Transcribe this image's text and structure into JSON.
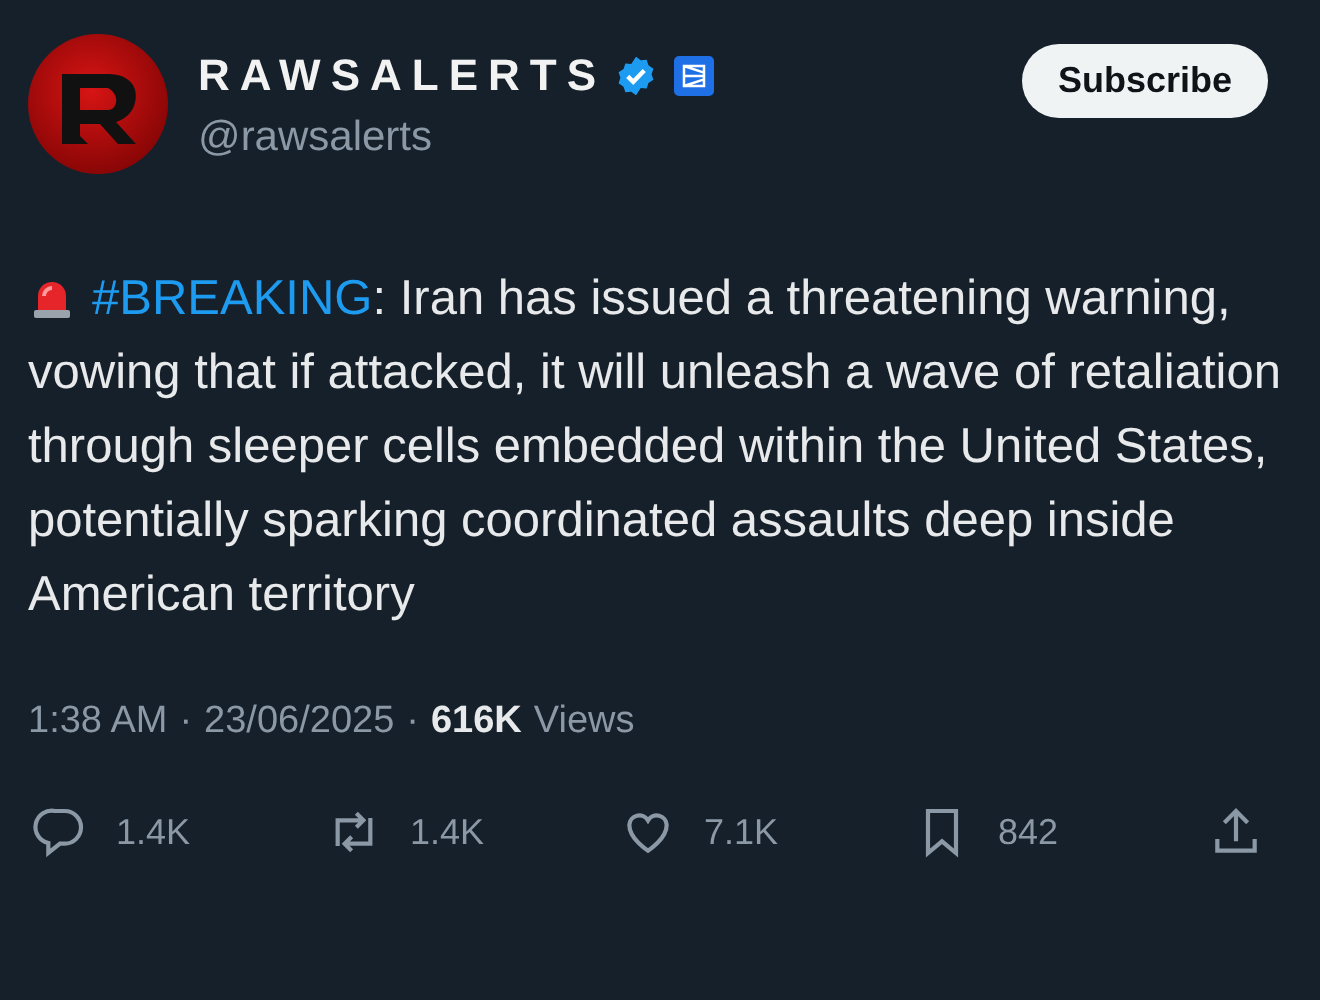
{
  "author": {
    "name": "RAWSALERTS",
    "handle": "@rawsalerts",
    "verified": true,
    "affiliate_badge": true
  },
  "subscribe_button": "Subscribe",
  "post": {
    "hashtag": "#BREAKING",
    "text": ": Iran has issued a threatening warning, vowing that if attacked, it will unleash a wave of retaliation through sleeper cells embedded within the United States, potentially sparking coordinated assaults deep inside American territory"
  },
  "meta": {
    "time": "1:38 AM",
    "separator_1": "·",
    "date": "23/06/2025",
    "separator_2": "·",
    "views_count": "616K",
    "views_label": "Views"
  },
  "actions": [
    {
      "kind": "reply",
      "count": "1.4K"
    },
    {
      "kind": "repost",
      "count": "1.4K"
    },
    {
      "kind": "like",
      "count": "7.1K"
    },
    {
      "kind": "bookmark",
      "count": "842"
    },
    {
      "kind": "share"
    }
  ]
}
